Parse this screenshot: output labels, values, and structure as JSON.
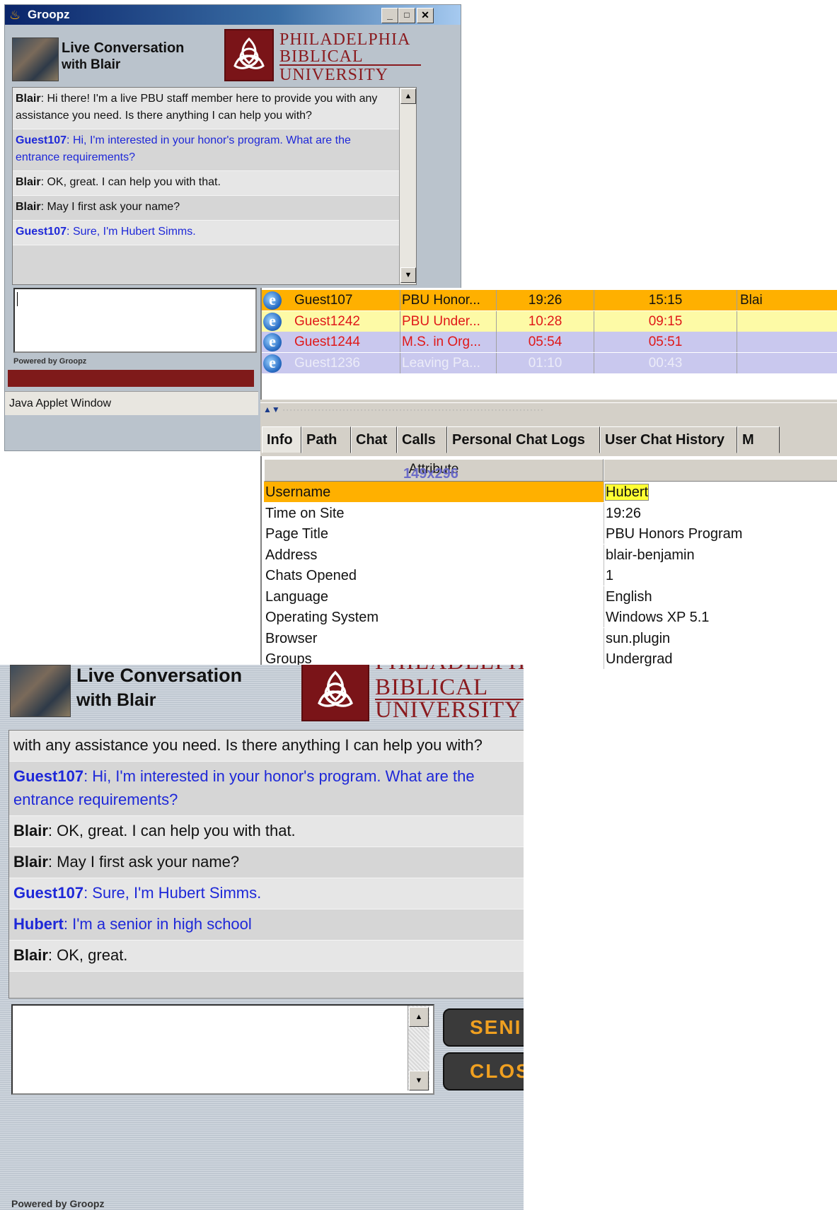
{
  "window": {
    "title": "Groopz",
    "minimize": "_",
    "maximize": "□",
    "close": "✕"
  },
  "header": {
    "line1": "Live Conversation",
    "with": "with",
    "agent_name": "Blair",
    "logo_icon": "trinity-knot-icon",
    "logo_line1": "PHILADELPHIA",
    "logo_line2": "BIBLICAL",
    "logo_line3": "UNIVERSITY"
  },
  "chat_small": [
    {
      "sender": "Blair",
      "text": ":  Hi there!  I'm a live PBU staff member here to provide you with any assistance you need. Is there anything I can help you with?",
      "role": "staff"
    },
    {
      "sender": "Guest107",
      "text": ":  Hi, I'm interested in your honor's program.  What are the entrance requirements?",
      "role": "guest"
    },
    {
      "sender": "Blair",
      "text": ":  OK, great.  I can help you with that.",
      "role": "staff"
    },
    {
      "sender": "Blair",
      "text": ":  May I first ask your name?",
      "role": "staff"
    },
    {
      "sender": "Guest107",
      "text": ":  Sure, I'm Hubert Simms.",
      "role": "guest"
    }
  ],
  "powered_by": "Powered by Groopz",
  "applet_label": "Java Applet Window",
  "visitors": [
    {
      "name": "Guest107",
      "page": "PBU Honor...",
      "time_on_site": "19:26",
      "time2": "15:15",
      "operator": "Blai",
      "bg": "#ffb000",
      "fg": "#111111"
    },
    {
      "name": "Guest1242",
      "page": "PBU Under...",
      "time_on_site": "10:28",
      "time2": "09:15",
      "operator": "",
      "bg": "#fdfaa6",
      "fg": "#e01818"
    },
    {
      "name": "Guest1244",
      "page": "M.S. in Org...",
      "time_on_site": "05:54",
      "time2": "05:51",
      "operator": "",
      "bg": "#c9c8ee",
      "fg": "#e01818"
    },
    {
      "name": "Guest1236",
      "page": "Leaving Pa...",
      "time_on_site": "01:10",
      "time2": "00:43",
      "operator": "",
      "bg": "#c9c8ee",
      "fg": "#ececf8"
    }
  ],
  "splitter_arrows": "▲▼",
  "tabs": [
    "Info",
    "Path",
    "Chat",
    "Calls",
    "Personal Chat Logs",
    "User Chat History",
    "M"
  ],
  "info_table": {
    "header": "Attribute",
    "overlay": "149x296",
    "rows": [
      {
        "attr": "Username",
        "value": "Hubert"
      },
      {
        "attr": "Time on Site",
        "value": "19:26"
      },
      {
        "attr": "Page Title",
        "value": "PBU Honors Program"
      },
      {
        "attr": "Address",
        "value": "blair-benjamin"
      },
      {
        "attr": "Chats Opened",
        "value": "1"
      },
      {
        "attr": "Language",
        "value": "English"
      },
      {
        "attr": "Operating System",
        "value": "Windows XP 5.1"
      },
      {
        "attr": "Browser",
        "value": "sun.plugin"
      },
      {
        "attr": "Groups",
        "value": "Undergrad"
      }
    ]
  },
  "chat_large": [
    {
      "sender": "",
      "text": "with any assistance you need. Is there anything I can help you with?",
      "role": "staff"
    },
    {
      "sender": "Guest107",
      "text": ":  Hi, I'm interested in your honor's program.  What are the entrance requirements?",
      "role": "guest"
    },
    {
      "sender": "Blair",
      "text": ":  OK, great.  I can help you with that.",
      "role": "staff"
    },
    {
      "sender": "Blair",
      "text": ":  May I first ask your name?",
      "role": "staff"
    },
    {
      "sender": "Guest107",
      "text": ":  Sure, I'm Hubert Simms.",
      "role": "guest"
    },
    {
      "sender": "Hubert",
      "text": ":  I'm a senior in high school",
      "role": "guest"
    },
    {
      "sender": "Blair",
      "text": ":  OK, great.",
      "role": "staff"
    }
  ],
  "buttons": {
    "send": "SENI",
    "close": "CLOS"
  }
}
